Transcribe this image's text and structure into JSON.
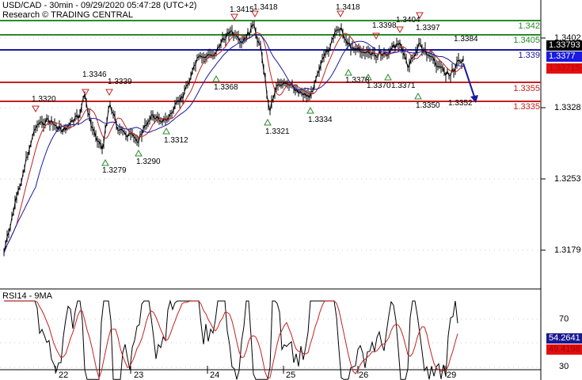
{
  "header": {
    "title": "USD/CAD - 30min - 09/29/2020 05:47:28 (UTC+2)",
    "subtitle": "Research © TRADING CENTRAL"
  },
  "levels": [
    {
      "label": "1.342",
      "color": "#2a8a2a"
    },
    {
      "label": "1.3405",
      "color": "#2a8a2a"
    },
    {
      "label": "1.339",
      "color": "#1a1aa0"
    },
    {
      "label": "1.3355",
      "color": "#c42020"
    },
    {
      "label": "1.3335",
      "color": "#c42020"
    }
  ],
  "price_axis": [
    "1.3402",
    "1.3328",
    "1.3253",
    "1.3179"
  ],
  "price_tags": {
    "last": "1.33793",
    "blue": "1.3377",
    "red": "1.33715"
  },
  "annotations": {
    "a1": "1.3320",
    "a2": "1.3346",
    "a3": "1.3339",
    "a4": "1.3415",
    "a5": "1.3418",
    "a6": "1.3418",
    "a7": "1.3398",
    "a8": "1.3404",
    "a9": "1.3397",
    "a10": "1.3384",
    "b1": "1.3279",
    "b2": "1.3290",
    "b3": "1.3312",
    "b4": "1.3368",
    "b5": "1.3321",
    "b6": "1.3334",
    "b7": "1.3378",
    "b8": "1.3370",
    "b9": "1.3371",
    "b10": "1.3350",
    "b11": "1.3352"
  },
  "rsi": {
    "title": "RSI14 - 9MA",
    "axis": [
      "70",
      "30"
    ],
    "value": "54.2641",
    "ma": "49.4198"
  },
  "days": [
    "22",
    "23",
    "24",
    "25",
    "26",
    "29"
  ],
  "colors": {
    "green": "#2a8a2a",
    "blue": "#1a1aa0",
    "red": "#c42020",
    "last": "#000000"
  }
}
